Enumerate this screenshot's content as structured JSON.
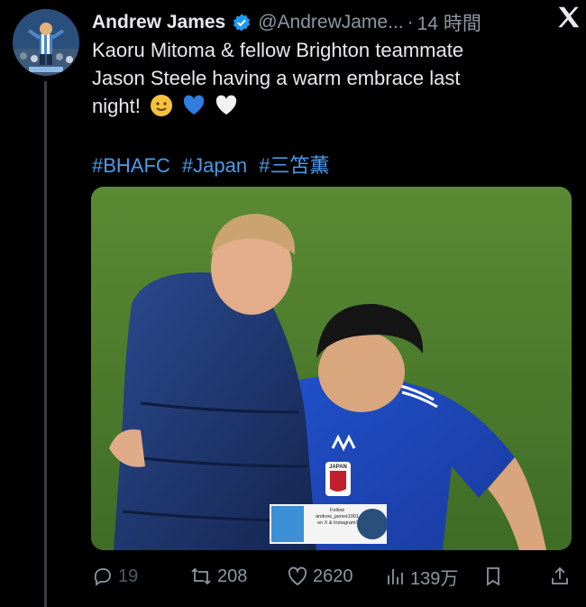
{
  "author": {
    "display_name": "Andrew James",
    "handle": "@AndrewJame...",
    "time": "14 時間",
    "verified_color": "#1d9bf0"
  },
  "tweet": {
    "lines": [
      "Kaoru Mitoma & fellow Brighton teammate",
      "Jason Steele having a warm embrace last",
      "night!"
    ],
    "emojis": [
      "slightly-smiling-face",
      "blue-heart",
      "white-heart"
    ],
    "hashtags": [
      "#BHAFC",
      "#Japan",
      "#三笘薫"
    ]
  },
  "media": {
    "kit_brand": "adidas",
    "crest_text": "JAPAN",
    "watermark_lines": [
      "Follow",
      "andrew_james1901",
      "on X & Instagram!"
    ]
  },
  "actions": {
    "replies": "19",
    "reposts": "208",
    "likes": "2620",
    "views": "139万"
  },
  "colors": {
    "background": "#000000",
    "text": "#e7e9ea",
    "muted": "#8b98a5",
    "hashtag": "#4c9be8",
    "pitch": "#4b7a2c"
  }
}
